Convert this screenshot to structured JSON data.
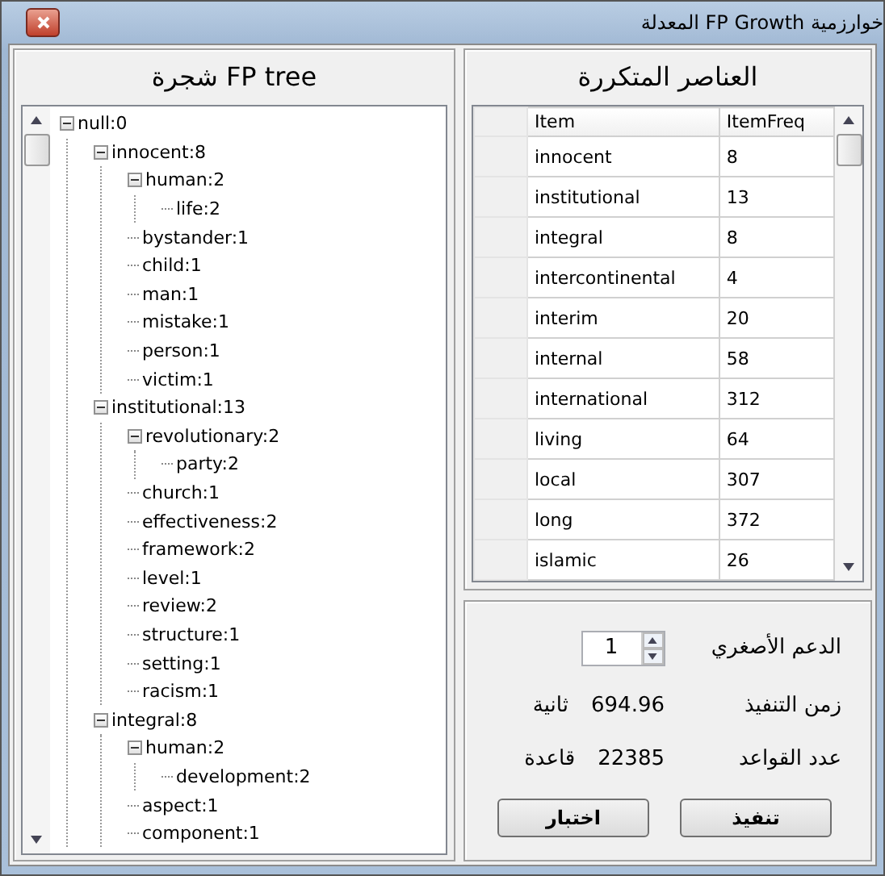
{
  "window": {
    "title": "خوارزمية FP Growth المعدلة"
  },
  "tree_panel": {
    "title": "شجرة FP tree",
    "nodes": [
      {
        "label": "null:0",
        "expanded": true,
        "children": [
          {
            "label": "innocent:8",
            "expanded": true,
            "children": [
              {
                "label": "human:2",
                "expanded": true,
                "children": [
                  {
                    "label": "life:2"
                  }
                ]
              },
              {
                "label": "bystander:1"
              },
              {
                "label": "child:1"
              },
              {
                "label": "man:1"
              },
              {
                "label": "mistake:1"
              },
              {
                "label": "person:1"
              },
              {
                "label": "victim:1"
              }
            ]
          },
          {
            "label": "institutional:13",
            "expanded": true,
            "children": [
              {
                "label": "revolutionary:2",
                "expanded": true,
                "children": [
                  {
                    "label": "party:2"
                  }
                ]
              },
              {
                "label": "church:1"
              },
              {
                "label": "effectiveness:2"
              },
              {
                "label": "framework:2"
              },
              {
                "label": "level:1"
              },
              {
                "label": "review:2"
              },
              {
                "label": "structure:1"
              },
              {
                "label": "setting:1"
              },
              {
                "label": "racism:1"
              }
            ]
          },
          {
            "label": "integral:8",
            "expanded": true,
            "children": [
              {
                "label": "human:2",
                "expanded": true,
                "children": [
                  {
                    "label": "development:2"
                  }
                ]
              },
              {
                "label": "aspect:1"
              },
              {
                "label": "component:1"
              }
            ]
          }
        ]
      }
    ]
  },
  "items_panel": {
    "title": "العناصر المتكررة",
    "columns": [
      "Item",
      "ItemFreq"
    ],
    "rows": [
      [
        "innocent",
        "8"
      ],
      [
        "institutional",
        "13"
      ],
      [
        "integral",
        "8"
      ],
      [
        "intercontinental",
        "4"
      ],
      [
        "interim",
        "20"
      ],
      [
        "internal",
        "58"
      ],
      [
        "international",
        "312"
      ],
      [
        "living",
        "64"
      ],
      [
        "local",
        "307"
      ],
      [
        "long",
        "372"
      ],
      [
        "islamic",
        "26"
      ]
    ]
  },
  "controls": {
    "min_support_label": "الدعم الأصغري",
    "min_support": "1",
    "exec_time_label": "زمن التنفيذ",
    "exec_time": "694.96",
    "exec_time_unit": "ثانية",
    "rules_label": "عدد القواعد",
    "rules": "22385",
    "rules_unit": "قاعدة",
    "buttons": [
      "تنفيذ",
      "اختبار"
    ]
  }
}
